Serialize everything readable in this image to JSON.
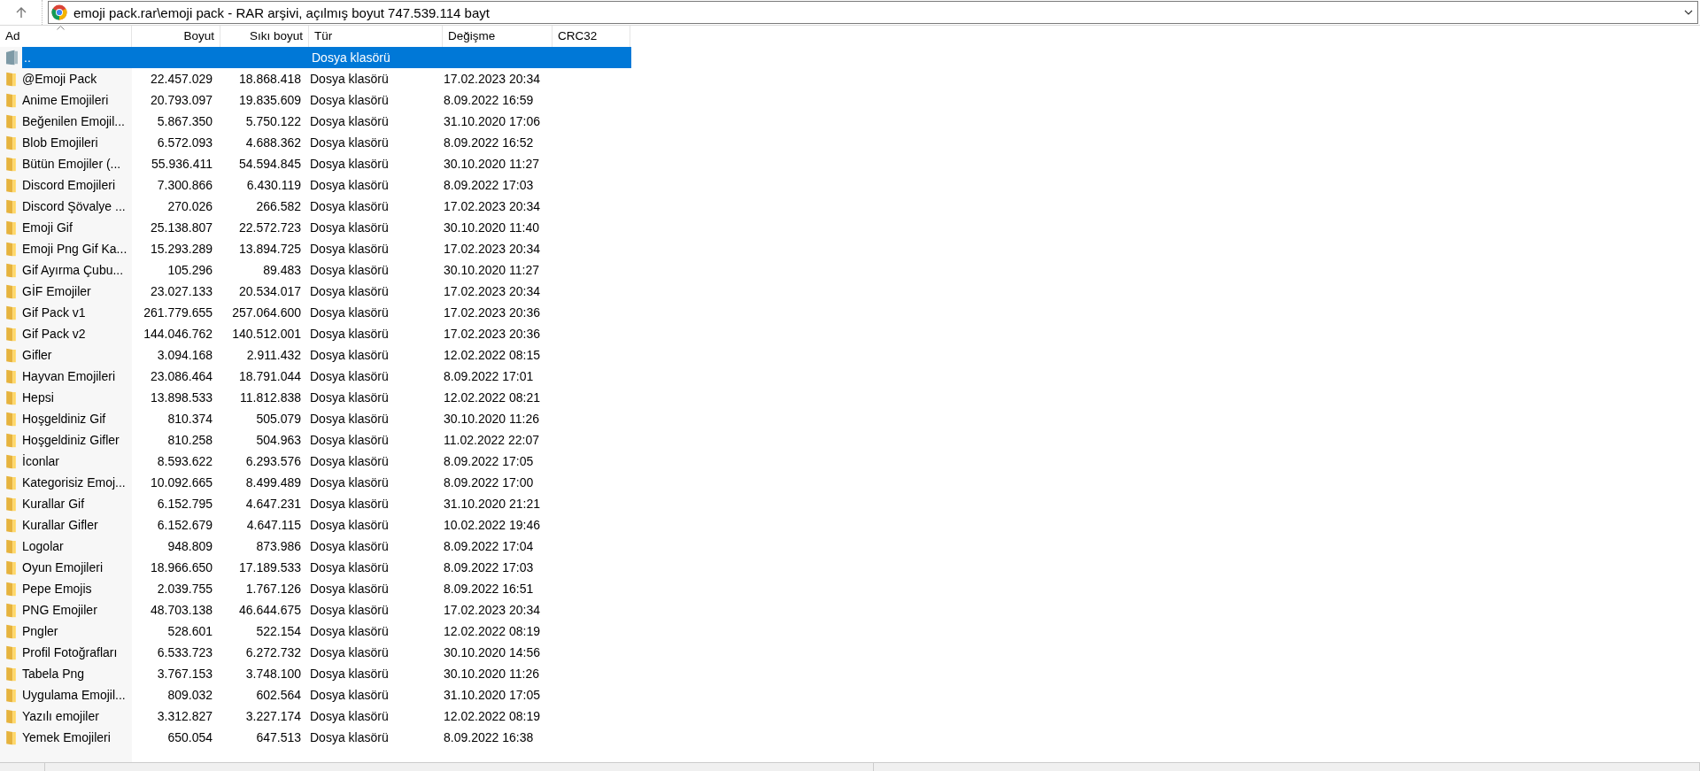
{
  "address_bar": {
    "value": "emoji pack.rar\\emoji pack - RAR arşivi, açılmış boyut 747.539.114 bayt"
  },
  "table": {
    "columns": [
      {
        "label": "Ad",
        "sorted": true
      },
      {
        "label": "Boyut",
        "sorted": false
      },
      {
        "label": "Sıkı boyut",
        "sorted": false
      },
      {
        "label": "Tür",
        "sorted": false
      },
      {
        "label": "Değişme",
        "sorted": false
      },
      {
        "label": "CRC32",
        "sorted": false
      }
    ],
    "rows": [
      {
        "kind": "parent",
        "name": "..",
        "type": "Dosya klasörü",
        "selected": true
      },
      {
        "kind": "folder",
        "name": "@Emoji Pack",
        "size": "22.457.029",
        "packed": "18.868.418",
        "type": "Dosya klasörü",
        "modified": "17.02.2023 20:34",
        "selected": false
      },
      {
        "kind": "folder",
        "name": "Anime Emojileri",
        "size": "20.793.097",
        "packed": "19.835.609",
        "type": "Dosya klasörü",
        "modified": "8.09.2022 16:59",
        "selected": false
      },
      {
        "kind": "folder",
        "name": "Beğenilen Emojil...",
        "size": "5.867.350",
        "packed": "5.750.122",
        "type": "Dosya klasörü",
        "modified": "31.10.2020 17:06",
        "selected": false
      },
      {
        "kind": "folder",
        "name": "Blob Emojileri",
        "size": "6.572.093",
        "packed": "4.688.362",
        "type": "Dosya klasörü",
        "modified": "8.09.2022 16:52",
        "selected": false
      },
      {
        "kind": "folder",
        "name": "Bütün Emojiler (...",
        "size": "55.936.411",
        "packed": "54.594.845",
        "type": "Dosya klasörü",
        "modified": "30.10.2020 11:27",
        "selected": false
      },
      {
        "kind": "folder",
        "name": "Discord Emojileri",
        "size": "7.300.866",
        "packed": "6.430.119",
        "type": "Dosya klasörü",
        "modified": "8.09.2022 17:03",
        "selected": false
      },
      {
        "kind": "folder",
        "name": "Discord Şövalye ...",
        "size": "270.026",
        "packed": "266.582",
        "type": "Dosya klasörü",
        "modified": "17.02.2023 20:34",
        "selected": false
      },
      {
        "kind": "folder",
        "name": "Emoji Gif",
        "size": "25.138.807",
        "packed": "22.572.723",
        "type": "Dosya klasörü",
        "modified": "30.10.2020 11:40",
        "selected": false
      },
      {
        "kind": "folder",
        "name": "Emoji Png Gif Ka...",
        "size": "15.293.289",
        "packed": "13.894.725",
        "type": "Dosya klasörü",
        "modified": "17.02.2023 20:34",
        "selected": false
      },
      {
        "kind": "folder",
        "name": "Gif Ayırma Çubu...",
        "size": "105.296",
        "packed": "89.483",
        "type": "Dosya klasörü",
        "modified": "30.10.2020 11:27",
        "selected": false
      },
      {
        "kind": "folder",
        "name": "GİF Emojiler",
        "size": "23.027.133",
        "packed": "20.534.017",
        "type": "Dosya klasörü",
        "modified": "17.02.2023 20:34",
        "selected": false
      },
      {
        "kind": "folder",
        "name": "Gif Pack v1",
        "size": "261.779.655",
        "packed": "257.064.600",
        "type": "Dosya klasörü",
        "modified": "17.02.2023 20:36",
        "selected": false
      },
      {
        "kind": "folder",
        "name": "Gif Pack v2",
        "size": "144.046.762",
        "packed": "140.512.001",
        "type": "Dosya klasörü",
        "modified": "17.02.2023 20:36",
        "selected": false
      },
      {
        "kind": "folder",
        "name": "Gifler",
        "size": "3.094.168",
        "packed": "2.911.432",
        "type": "Dosya klasörü",
        "modified": "12.02.2022 08:15",
        "selected": false
      },
      {
        "kind": "folder",
        "name": "Hayvan Emojileri",
        "size": "23.086.464",
        "packed": "18.791.044",
        "type": "Dosya klasörü",
        "modified": "8.09.2022 17:01",
        "selected": false
      },
      {
        "kind": "folder",
        "name": "Hepsi",
        "size": "13.898.533",
        "packed": "11.812.838",
        "type": "Dosya klasörü",
        "modified": "12.02.2022 08:21",
        "selected": false
      },
      {
        "kind": "folder",
        "name": "Hoşgeldiniz Gif",
        "size": "810.374",
        "packed": "505.079",
        "type": "Dosya klasörü",
        "modified": "30.10.2020 11:26",
        "selected": false
      },
      {
        "kind": "folder",
        "name": "Hoşgeldiniz Gifler",
        "size": "810.258",
        "packed": "504.963",
        "type": "Dosya klasörü",
        "modified": "11.02.2022 22:07",
        "selected": false
      },
      {
        "kind": "folder",
        "name": "İconlar",
        "size": "8.593.622",
        "packed": "6.293.576",
        "type": "Dosya klasörü",
        "modified": "8.09.2022 17:05",
        "selected": false
      },
      {
        "kind": "folder",
        "name": "Kategorisiz Emoj...",
        "size": "10.092.665",
        "packed": "8.499.489",
        "type": "Dosya klasörü",
        "modified": "8.09.2022 17:00",
        "selected": false
      },
      {
        "kind": "folder",
        "name": "Kurallar Gif",
        "size": "6.152.795",
        "packed": "4.647.231",
        "type": "Dosya klasörü",
        "modified": "31.10.2020 21:21",
        "selected": false
      },
      {
        "kind": "folder",
        "name": "Kurallar Gifler",
        "size": "6.152.679",
        "packed": "4.647.115",
        "type": "Dosya klasörü",
        "modified": "10.02.2022 19:46",
        "selected": false
      },
      {
        "kind": "folder",
        "name": "Logolar",
        "size": "948.809",
        "packed": "873.986",
        "type": "Dosya klasörü",
        "modified": "8.09.2022 17:04",
        "selected": false
      },
      {
        "kind": "folder",
        "name": "Oyun Emojileri",
        "size": "18.966.650",
        "packed": "17.189.533",
        "type": "Dosya klasörü",
        "modified": "8.09.2022 17:03",
        "selected": false
      },
      {
        "kind": "folder",
        "name": "Pepe Emojis",
        "size": "2.039.755",
        "packed": "1.767.126",
        "type": "Dosya klasörü",
        "modified": "8.09.2022 16:51",
        "selected": false
      },
      {
        "kind": "folder",
        "name": "PNG Emojiler",
        "size": "48.703.138",
        "packed": "46.644.675",
        "type": "Dosya klasörü",
        "modified": "17.02.2023 20:34",
        "selected": false
      },
      {
        "kind": "folder",
        "name": "Pngler",
        "size": "528.601",
        "packed": "522.154",
        "type": "Dosya klasörü",
        "modified": "12.02.2022 08:19",
        "selected": false
      },
      {
        "kind": "folder",
        "name": "Profil Fotoğrafları",
        "size": "6.533.723",
        "packed": "6.272.732",
        "type": "Dosya klasörü",
        "modified": "30.10.2020 14:56",
        "selected": false
      },
      {
        "kind": "folder",
        "name": "Tabela Png",
        "size": "3.767.153",
        "packed": "3.748.100",
        "type": "Dosya klasörü",
        "modified": "30.10.2020 11:26",
        "selected": false
      },
      {
        "kind": "folder",
        "name": "Uygulama Emojil...",
        "size": "809.032",
        "packed": "602.564",
        "type": "Dosya klasörü",
        "modified": "31.10.2020 17:05",
        "selected": false
      },
      {
        "kind": "folder",
        "name": "Yazılı emojiler",
        "size": "3.312.827",
        "packed": "3.227.174",
        "type": "Dosya klasörü",
        "modified": "12.02.2022 08:19",
        "selected": false
      },
      {
        "kind": "folder",
        "name": "Yemek Emojileri",
        "size": "650.054",
        "packed": "647.513",
        "type": "Dosya klasörü",
        "modified": "8.09.2022 16:38",
        "selected": false
      }
    ]
  }
}
